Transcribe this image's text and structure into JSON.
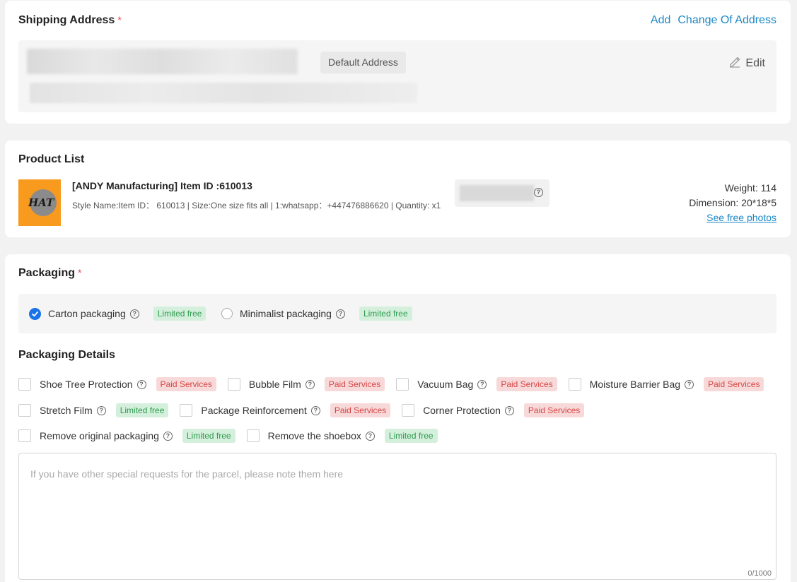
{
  "shipping": {
    "title": "Shipping Address",
    "required_mark": "*",
    "add_label": "Add",
    "change_label": "Change Of Address",
    "default_badge": "Default Address",
    "edit_label": "Edit"
  },
  "product": {
    "section_title": "Product List",
    "logo_text": "HAT",
    "title": "[ANDY Manufacturing] Item ID :610013",
    "desc": "Style Name:Item ID： 610013 |  Size:One size fits all |  1:whatsapp：+447476886620 |  Quantity: x1",
    "weight": "Weight: 114",
    "dimension": "Dimension: 20*18*5",
    "photos_link": "See free photos"
  },
  "packaging": {
    "title": "Packaging",
    "required_mark": "*",
    "options": [
      {
        "label": "Carton packaging",
        "tag": "Limited free",
        "selected": true
      },
      {
        "label": "Minimalist packaging",
        "tag": "Limited free",
        "selected": false
      }
    ],
    "details_title": "Packaging Details",
    "details": [
      {
        "label": "Shoe Tree Protection",
        "tag": "Paid Services",
        "kind": "paid"
      },
      {
        "label": "Bubble Film",
        "tag": "Paid Services",
        "kind": "paid"
      },
      {
        "label": "Vacuum Bag",
        "tag": "Paid Services",
        "kind": "paid"
      },
      {
        "label": "Moisture Barrier Bag",
        "tag": "Paid Services",
        "kind": "paid"
      },
      {
        "label": "Stretch Film",
        "tag": "Limited free",
        "kind": "free"
      },
      {
        "label": "Package Reinforcement",
        "tag": "Paid Services",
        "kind": "paid"
      },
      {
        "label": "Corner Protection",
        "tag": "Paid Services",
        "kind": "paid"
      },
      {
        "label": "Remove original packaging",
        "tag": "Limited free",
        "kind": "free"
      },
      {
        "label": "Remove the shoebox",
        "tag": "Limited free",
        "kind": "free"
      }
    ],
    "notes_placeholder": "If you have other special requests for the parcel, please note them here",
    "notes_count": "0/1000"
  },
  "colors": {
    "accent": "#1a88c7",
    "required": "#e5484d",
    "free_bg": "#d4f0dc",
    "free_text": "#2e9a4f",
    "paid_bg": "#f8d9d9",
    "paid_text": "#d64545",
    "checked": "#1a73e8"
  },
  "icons": [
    "edit-pencil-icon",
    "help-circle-icon",
    "check-icon"
  ]
}
